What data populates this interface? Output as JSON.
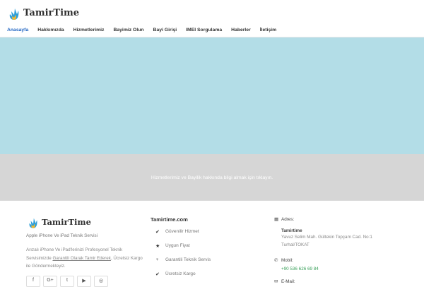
{
  "header": {
    "logo_text": "TamirTime",
    "logo_icon": "flame-logo-icon",
    "nav": [
      {
        "label": "Anasayfa",
        "active": true
      },
      {
        "label": "Hakkımızda"
      },
      {
        "label": "Hizmetlerimiz"
      },
      {
        "label": "Bayimiz Olun"
      },
      {
        "label": "Bayi Girişi"
      },
      {
        "label": "IMEI Sorgulama"
      },
      {
        "label": "Haberler"
      },
      {
        "label": "İletişim"
      }
    ]
  },
  "cta": {
    "text": "Hizmetlerimiz ve Bayilik hakkında bilgi almak için tıklayın."
  },
  "footer": {
    "logo_text": "TamirTime",
    "tagline": "Apple iPhone Ve iPad Teknik Servisi",
    "description": {
      "line1": "Arızalı iPhone Ve iPad'lerinizi Profesyonel Teknik",
      "line2_pre": "Servisimizde ",
      "line2_link": "Garantili Olarak Tamir Ederek",
      "line2_post": ", Ücretsiz Kargo",
      "line3": "ile Göndermekteyiz."
    },
    "socials": [
      {
        "icon": "facebook-icon",
        "glyph": "f"
      },
      {
        "icon": "google-plus-icon",
        "glyph": "G+"
      },
      {
        "icon": "twitter-icon",
        "glyph": "t"
      },
      {
        "icon": "youtube-icon",
        "glyph": "▶"
      },
      {
        "icon": "instagram-icon",
        "glyph": "◎"
      }
    ],
    "col2_title": "Tamirtime.com",
    "services": [
      {
        "icon": "check-icon",
        "glyph": "✔",
        "label": "Güvenilir Hizmet"
      },
      {
        "icon": "star-icon",
        "glyph": "★",
        "label": "Uygun Fiyat"
      },
      {
        "icon": "lightbulb-icon",
        "glyph": "♀",
        "label": "Garantili Teknik Servis"
      },
      {
        "icon": "check-icon",
        "glyph": "✔",
        "label": "Ücretsiz Kargo"
      }
    ],
    "contact": {
      "address_label": "Adres:",
      "address_name": "Tamirtime",
      "address_line1": "Yavuz Selim Mah. Gültekin Topçam Cad. No:1",
      "address_line2": "Turhal/TOKAT",
      "mobile_label": "Mobil:",
      "phone": "+90 536 626 69 84",
      "email_label": "E-Mail:"
    }
  },
  "colors": {
    "hero": "#b3dde7",
    "cta_band": "#d6d6d6",
    "nav_active": "#1f64c2",
    "phone": "#3aa05a"
  }
}
